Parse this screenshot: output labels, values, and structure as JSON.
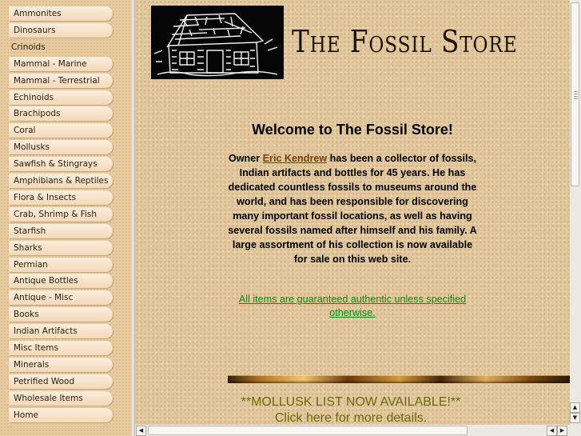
{
  "nav": {
    "items": [
      {
        "label": "Ammonites"
      },
      {
        "label": "Dinosaurs"
      },
      {
        "label": "Crinoids"
      },
      {
        "label": "Mammal - Marine"
      },
      {
        "label": "Mammal - Terrestrial"
      },
      {
        "label": "Echinoids"
      },
      {
        "label": "Brachipods"
      },
      {
        "label": "Coral"
      },
      {
        "label": "Mollusks"
      },
      {
        "label": "Sawfish & Stingrays"
      },
      {
        "label": "Amphibians & Reptiles"
      },
      {
        "label": "Flora & Insects"
      },
      {
        "label": "Crab, Shrimp & Fish"
      },
      {
        "label": "Starfish"
      },
      {
        "label": "Sharks"
      },
      {
        "label": "Permian"
      },
      {
        "label": "Antique Bottles"
      },
      {
        "label": "Antique - Misc"
      },
      {
        "label": "Books"
      },
      {
        "label": "Indian Artifacts"
      },
      {
        "label": "Misc Items"
      },
      {
        "label": "Minerals"
      },
      {
        "label": "Petrified Wood"
      },
      {
        "label": "Wholesale Items"
      },
      {
        "label": "Home"
      }
    ]
  },
  "header": {
    "title": "The Fossil Store"
  },
  "content": {
    "welcome": "Welcome to The Fossil Store!",
    "intro_before": "Owner ",
    "owner_link": "Eric Kendrew",
    "intro_after": " has been a collector of fossils, Indian artifacts and bottles for 45 years.  He has dedicated countless fossils to museums around the world, and has been responsible for discovering many important fossil locations, as well as having several fossils named after himself and his family.  A large assortment of his collection is now available for sale on this web site.",
    "guarantee": "All items are guaranteed authentic unless specified otherwise.",
    "mollusk_notice": "**MOLLUSK LIST NOW AVAILABLE!**",
    "click_details": "Click here for more details."
  },
  "colors": {
    "nav_bg": "#e9cba0",
    "main_bg": "#e2c89c",
    "link_brown": "#7a3d07",
    "link_green": "#0a8a12",
    "notice_olive": "#6b6b0a"
  }
}
